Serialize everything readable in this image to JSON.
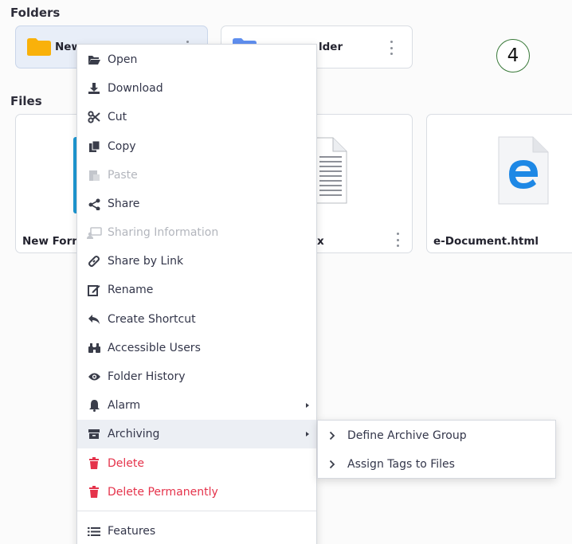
{
  "sections": {
    "folders_title": "Folders",
    "files_title": "Files"
  },
  "folders": [
    {
      "name": "New",
      "selected": true
    },
    {
      "name": "lder",
      "selected": false
    }
  ],
  "step_badge": "4",
  "files": [
    {
      "name": "New Form"
    },
    {
      "name": "x"
    },
    {
      "name": "e-Document.html"
    }
  ],
  "context_menu": {
    "items": [
      {
        "label": "Open",
        "icon": "folder-open-icon"
      },
      {
        "label": "Download",
        "icon": "download-icon"
      },
      {
        "label": "Cut",
        "icon": "scissors-icon"
      },
      {
        "label": "Copy",
        "icon": "copy-icon"
      },
      {
        "label": "Paste",
        "icon": "paste-icon",
        "disabled": true
      },
      {
        "label": "Share",
        "icon": "share-icon"
      },
      {
        "label": "Sharing Information",
        "icon": "sharing-info-icon",
        "disabled": true
      },
      {
        "label": "Share by Link",
        "icon": "link-icon"
      },
      {
        "label": "Rename",
        "icon": "rename-icon"
      },
      {
        "label": "Create Shortcut",
        "icon": "shortcut-icon"
      },
      {
        "label": "Accessible Users",
        "icon": "binoculars-icon"
      },
      {
        "label": "Folder History",
        "icon": "eye-icon"
      },
      {
        "label": "Alarm",
        "icon": "bell-icon",
        "has_submenu": true
      },
      {
        "label": "Archiving",
        "icon": "archive-icon",
        "has_submenu": true,
        "highlighted": true
      },
      {
        "label": "Delete",
        "icon": "trash-icon",
        "danger": true
      },
      {
        "label": "Delete Permanently",
        "icon": "trash-icon",
        "danger": true
      },
      {
        "label": "Features",
        "icon": "list-icon"
      }
    ]
  },
  "archiving_submenu": {
    "items": [
      {
        "label": "Define Archive Group"
      },
      {
        "label": "Assign Tags to Files"
      }
    ]
  },
  "colors": {
    "accent_blue": "#1e88e5",
    "danger": "#e5334b",
    "folder_yellow": "#f9b10a",
    "folder_blue": "#5f8ff0"
  }
}
